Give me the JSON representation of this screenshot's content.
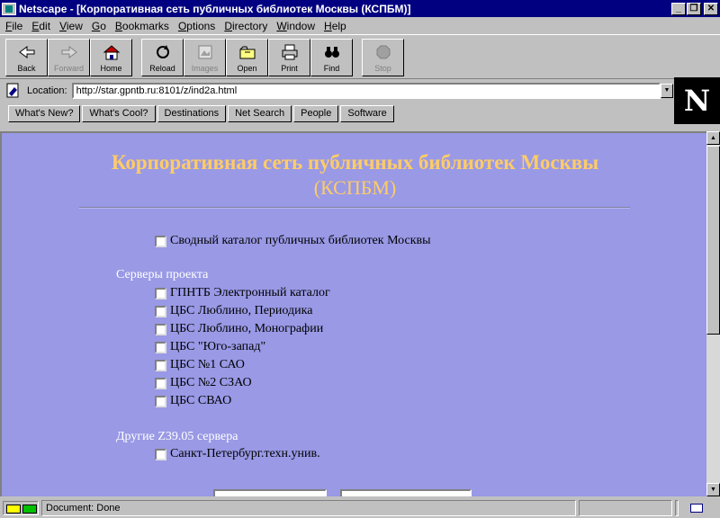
{
  "window": {
    "title": "Netscape - [Корпоративная сеть публичных библиотек Москвы (КСПБМ)]",
    "minimize": "_",
    "maximize": "❐",
    "close": "✕"
  },
  "menu": [
    {
      "key": "F",
      "rest": "ile"
    },
    {
      "key": "E",
      "rest": "dit"
    },
    {
      "key": "V",
      "rest": "iew"
    },
    {
      "key": "G",
      "rest": "o"
    },
    {
      "key": "B",
      "rest": "ookmarks"
    },
    {
      "key": "O",
      "rest": "ptions"
    },
    {
      "key": "D",
      "rest": "irectory"
    },
    {
      "key": "W",
      "rest": "indow"
    },
    {
      "key": "H",
      "rest": "elp"
    }
  ],
  "toolbar": {
    "back": "Back",
    "forward": "Forward",
    "home": "Home",
    "reload": "Reload",
    "images": "Images",
    "open": "Open",
    "print": "Print",
    "find": "Find",
    "stop": "Stop"
  },
  "location": {
    "label": "Location:",
    "url": "http://star.gpntb.ru:8101/z/ind2a.html"
  },
  "directory_buttons": [
    "What's New?",
    "What's Cool?",
    "Destinations",
    "Net Search",
    "People",
    "Software"
  ],
  "logo": {
    "letter": "N"
  },
  "page": {
    "title": "Корпоративная сеть публичных библиотек Москвы",
    "subtitle": "(КСПБМ)",
    "union_catalog": "Сводный каталог публичных библиотек Москвы",
    "project_servers_label": "Серверы проекта",
    "project_servers": [
      "ГПНТБ Электронный каталог",
      "ЦБС Люблино, Периодика",
      "ЦБС Люблино, Монографии",
      "ЦБС \"Юго-запад\"",
      "ЦБС №1 САО",
      "ЦБС №2 СЗАО",
      "ЦБС СВАО"
    ],
    "other_servers_label": "Другие Z39.05 сервера",
    "other_servers": [
      "Санкт-Петербург.техн.унив."
    ]
  },
  "status": {
    "text": "Document: Done"
  },
  "colors": {
    "page_background": "#9999e6",
    "title_color": "#ffcc66",
    "titlebar": "#000080"
  }
}
